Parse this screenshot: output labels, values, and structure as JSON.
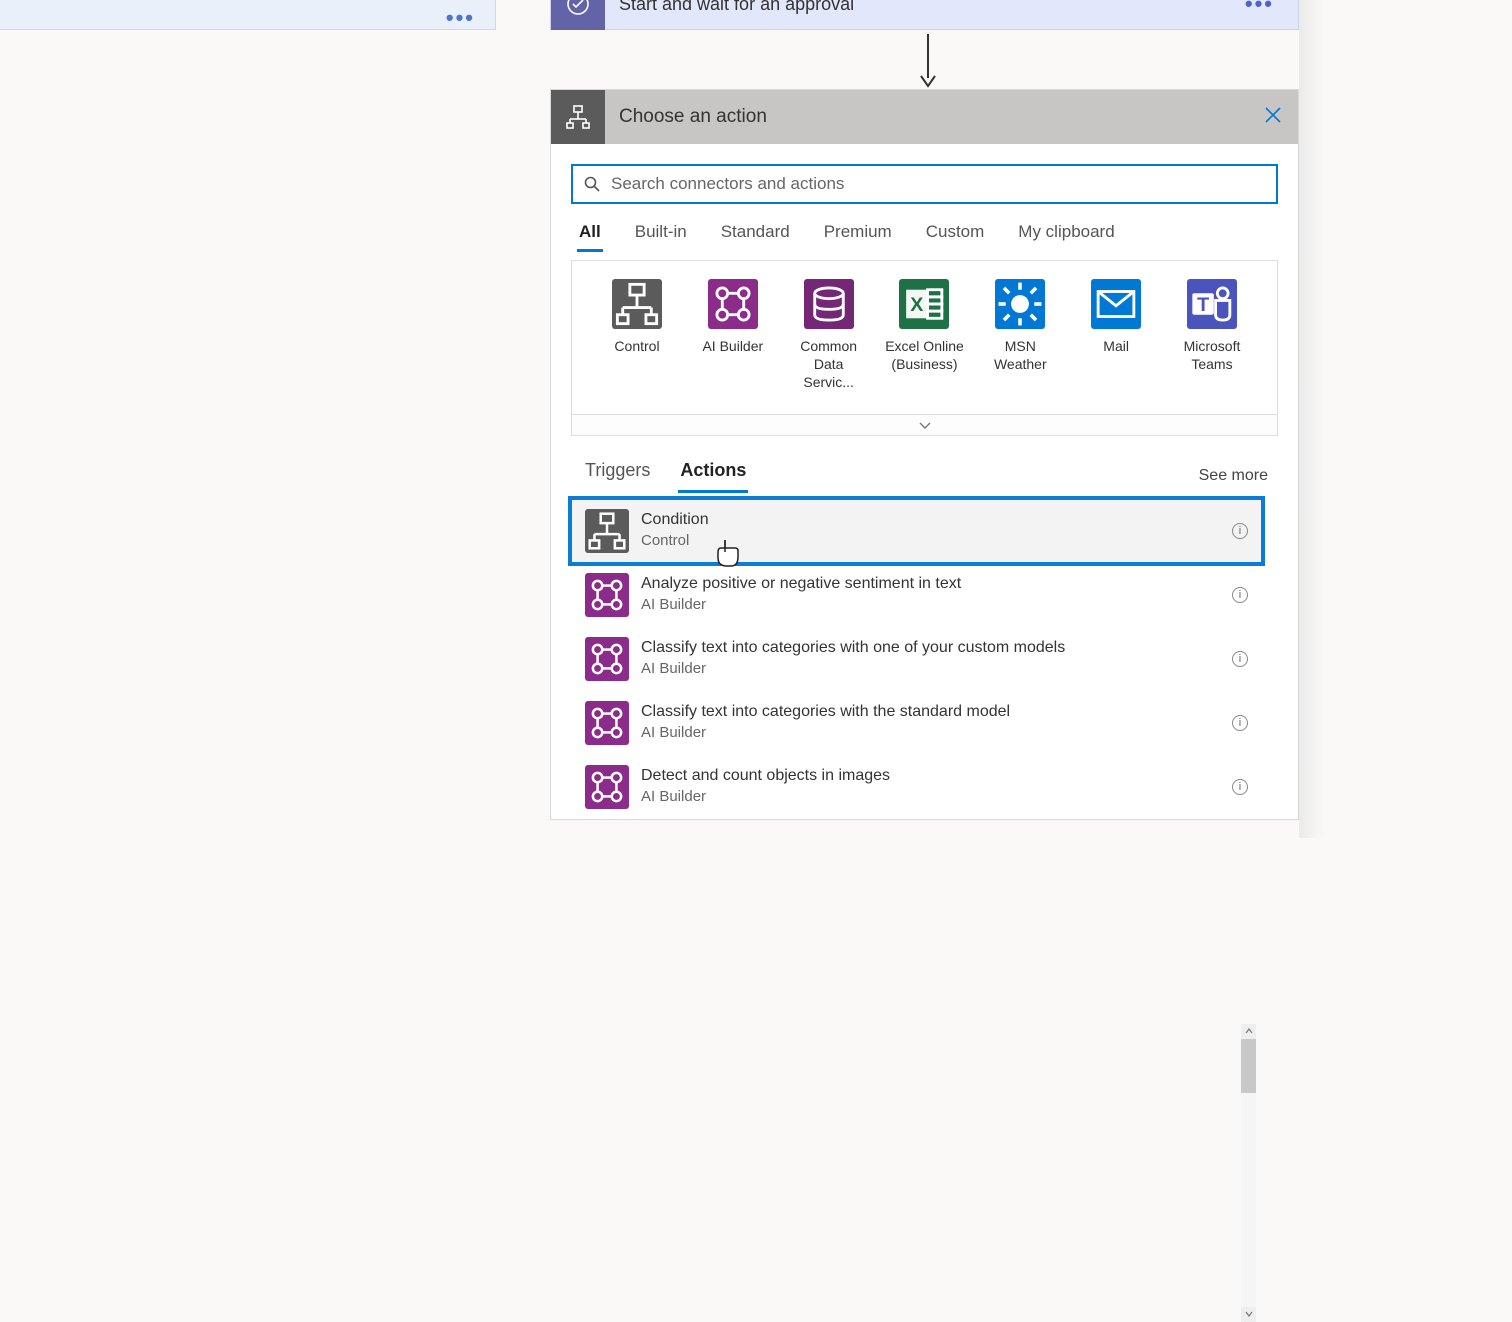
{
  "leftCard": {
    "dots": "•••"
  },
  "approval": {
    "title": "Start and wait for an approval",
    "dots": "•••"
  },
  "choose": {
    "title": "Choose an action"
  },
  "search": {
    "placeholder": "Search connectors and actions"
  },
  "filterTabs": [
    "All",
    "Built-in",
    "Standard",
    "Premium",
    "Custom",
    "My clipboard"
  ],
  "filterActiveIndex": 0,
  "connectors": [
    {
      "name": "Control",
      "class": "c-control",
      "icon": "control"
    },
    {
      "name": "AI Builder",
      "class": "c-ai",
      "icon": "ai"
    },
    {
      "name": "Common Data Servic...",
      "class": "c-cds",
      "icon": "cds"
    },
    {
      "name": "Excel Online (Business)",
      "class": "c-excel",
      "icon": "excel"
    },
    {
      "name": "MSN Weather",
      "class": "c-msn",
      "icon": "weather"
    },
    {
      "name": "Mail",
      "class": "c-mail",
      "icon": "mail"
    },
    {
      "name": "Microsoft Teams",
      "class": "c-teams",
      "icon": "teams"
    }
  ],
  "taTabs": [
    "Triggers",
    "Actions"
  ],
  "taActiveIndex": 1,
  "seeMore": "See more",
  "actions": [
    {
      "title": "Condition",
      "sub": "Control",
      "class": "c-control",
      "icon": "control",
      "highlighted": true,
      "hover": true
    },
    {
      "title": "Analyze positive or negative sentiment in text",
      "sub": "AI Builder",
      "class": "c-ai",
      "icon": "ai"
    },
    {
      "title": "Classify text into categories with one of your custom models",
      "sub": "AI Builder",
      "class": "c-ai",
      "icon": "ai"
    },
    {
      "title": "Classify text into categories with the standard model",
      "sub": "AI Builder",
      "class": "c-ai",
      "icon": "ai"
    },
    {
      "title": "Detect and count objects in images",
      "sub": "AI Builder",
      "class": "c-ai",
      "icon": "ai"
    }
  ],
  "infoGlyph": "i"
}
